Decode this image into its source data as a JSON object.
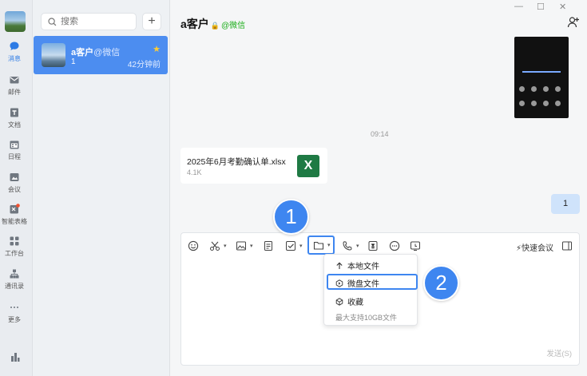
{
  "rail": {
    "items": [
      {
        "label": "消息",
        "icon": "chat-icon"
      },
      {
        "label": "邮件",
        "icon": "mail-icon"
      },
      {
        "label": "文档",
        "icon": "doc-icon"
      },
      {
        "label": "日程",
        "icon": "calendar-icon"
      },
      {
        "label": "会议",
        "icon": "meeting-icon"
      },
      {
        "label": "智能表格",
        "icon": "smart-table-icon"
      },
      {
        "label": "工作台",
        "icon": "workbench-icon"
      },
      {
        "label": "通讯录",
        "icon": "contacts-icon"
      },
      {
        "label": "更多",
        "icon": "more-icon"
      }
    ],
    "accent": "#2d7be5"
  },
  "search": {
    "placeholder": "搜索"
  },
  "add_label": "+",
  "conversation": {
    "name": "a客户",
    "source": "@微信",
    "last_message": "1",
    "time": "42分钟前",
    "highlight_color": "#4c8df0"
  },
  "window": {
    "minimize": "—",
    "maximize": "☐",
    "close": "✕"
  },
  "chat": {
    "title": "a客户",
    "source": "@微信",
    "timestamp": "09:14",
    "file": {
      "name": "2025年6月考勤确认单.xlsx",
      "size": "4.1K",
      "badge": "X"
    },
    "my_message": "1"
  },
  "composer": {
    "quick_meeting": "快速会议",
    "send_label": "发送(S)",
    "caret": "▾"
  },
  "menu": {
    "items": [
      {
        "label": "本地文件",
        "icon": "upload-icon"
      },
      {
        "label": "微盘文件",
        "icon": "cloud-drive-icon"
      },
      {
        "label": "收藏",
        "icon": "favorite-box-icon"
      }
    ],
    "note": "最大支持10GB文件"
  },
  "annotations": {
    "step1": "1",
    "step2": "2",
    "color": "#3e86f0"
  }
}
